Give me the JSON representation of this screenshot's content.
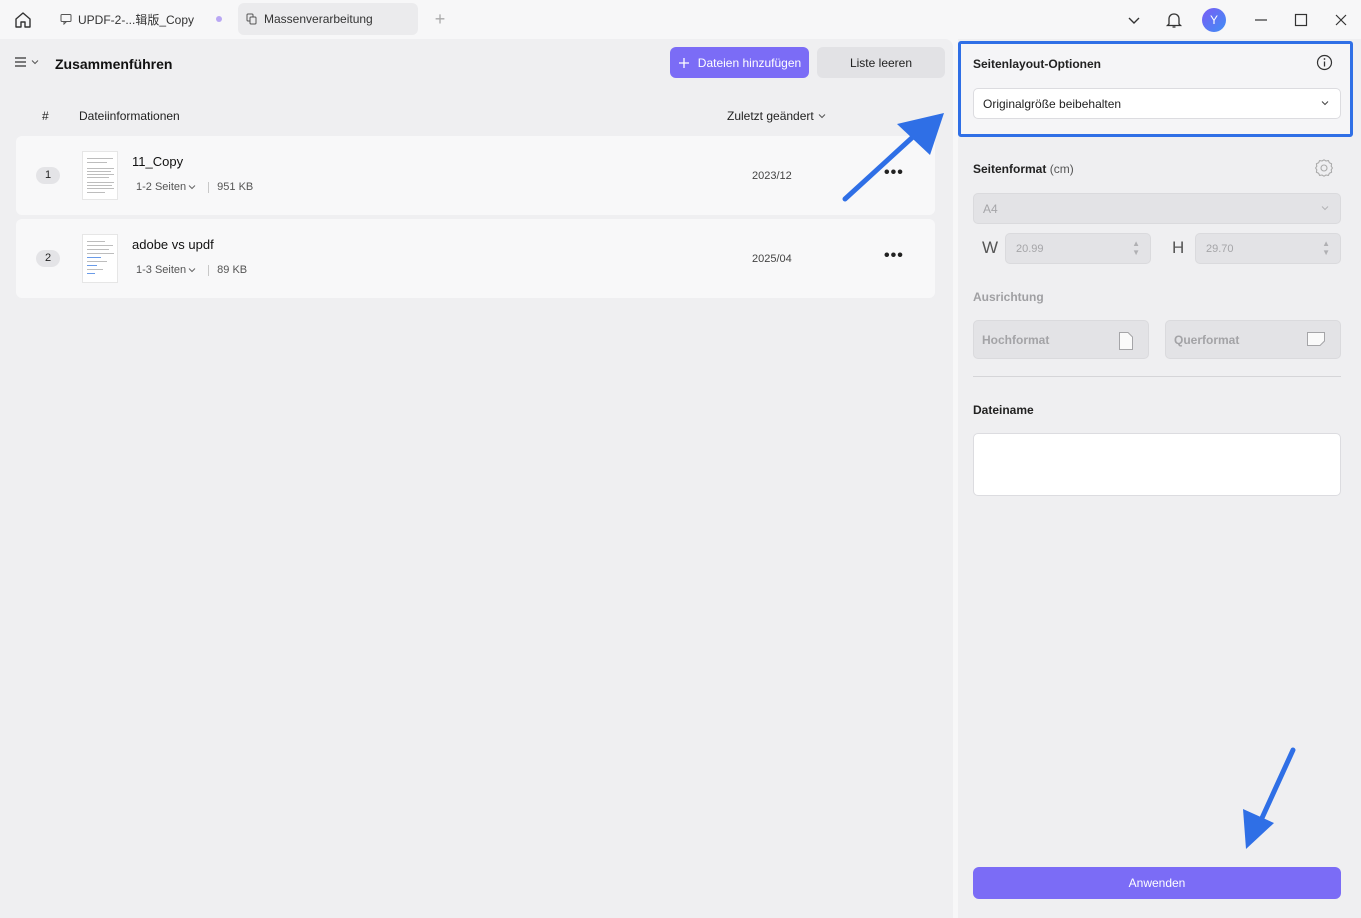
{
  "titlebar": {
    "tabs": [
      {
        "label": "UPDF-2-...辑版_Copy",
        "active": false
      },
      {
        "label": "Massenverarbeitung",
        "active": true
      }
    ],
    "avatar_initial": "Y"
  },
  "main": {
    "title": "Zusammenführen",
    "add_files_label": "Dateien hinzufügen",
    "clear_list_label": "Liste leeren",
    "columns": {
      "number": "#",
      "file_info": "Dateiinformationen",
      "last_modified": "Zuletzt geändert"
    },
    "files": [
      {
        "index": "1",
        "name": "11_Copy",
        "pages": "1-2 Seiten",
        "size": "951 KB",
        "date": "2023/12"
      },
      {
        "index": "2",
        "name": "adobe vs updf",
        "pages": "1-3 Seiten",
        "size": "89 KB",
        "date": "2025/04"
      }
    ]
  },
  "panel": {
    "layout_options_label": "Seitenlayout-Optionen",
    "layout_option_value": "Originalgröße beibehalten",
    "page_format_label": "Seitenformat",
    "page_format_unit": "(cm)",
    "page_format_value": "A4",
    "width_letter": "W",
    "width_value": "20.99",
    "height_letter": "H",
    "height_value": "29.70",
    "orientation_label": "Ausrichtung",
    "portrait_label": "Hochformat",
    "landscape_label": "Querformat",
    "filename_label": "Dateiname",
    "filename_value": "",
    "apply_label": "Anwenden"
  },
  "colors": {
    "accent": "#7b6cf6",
    "highlight_border": "#2f6fe6",
    "annotation_arrow": "#2f6fe6"
  }
}
